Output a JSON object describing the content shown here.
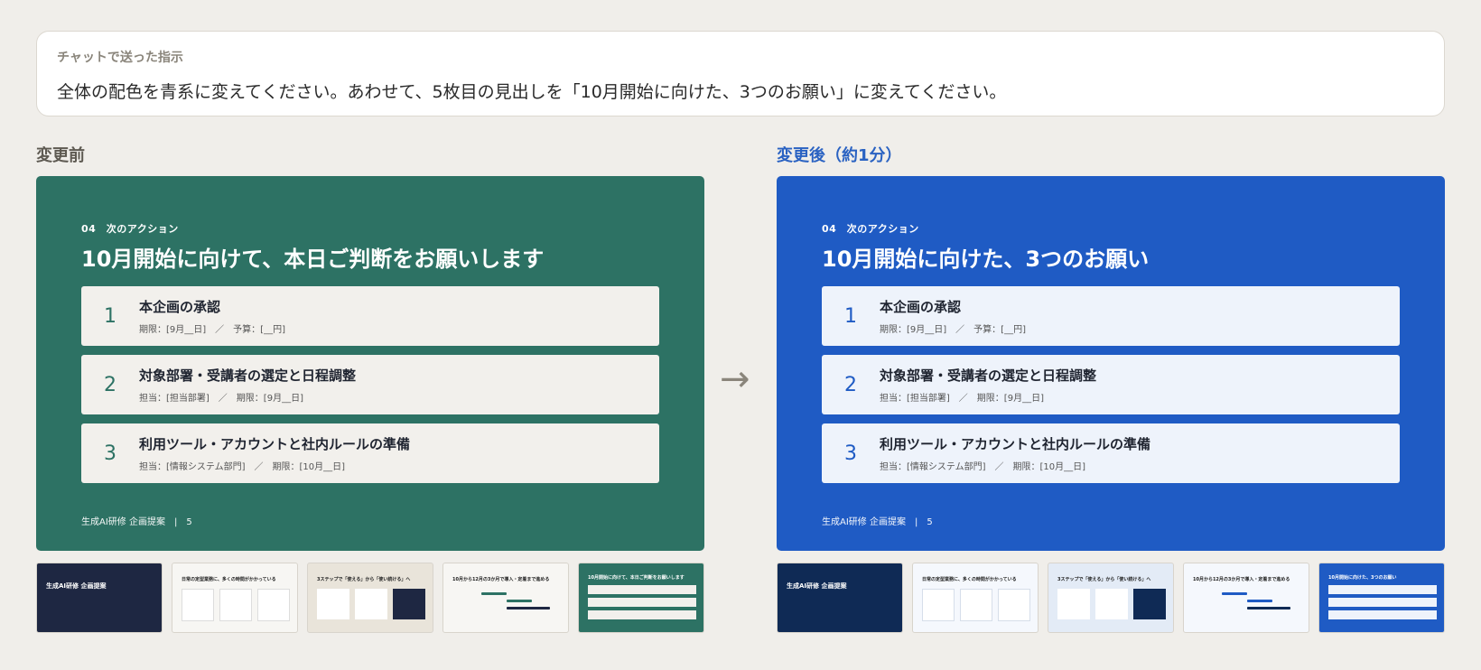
{
  "instruction": {
    "label": "チャットで送った指示",
    "text": "全体の配色を青系に変えてください。あわせて、5枚目の見出しを「10月開始に向けた、3つのお願い」に変えてください。"
  },
  "before": {
    "section_title": "変更前",
    "slide": {
      "kicker": "04　次のアクション",
      "headline": "10月開始に向けて、本日ご判断をお願いします",
      "items": [
        {
          "num": "1",
          "title": "本企画の承認",
          "meta": "期限：[9月__日]　／　予算：[__円]"
        },
        {
          "num": "2",
          "title": "対象部署・受講者の選定と日程調整",
          "meta": "担当：[担当部署]　／　期限：[9月__日]"
        },
        {
          "num": "3",
          "title": "利用ツール・アカウントと社内ルールの準備",
          "meta": "担当：[情報システム部門]　／　期限：[10月__日]"
        }
      ],
      "footer": "生成AI研修 企画提案",
      "page": "5"
    },
    "thumbs": [
      {
        "title": "生成AI研修 企画提案"
      },
      {
        "title": "日常の定型業務に、多くの時間がかかっている"
      },
      {
        "title": "3ステップで「使える」から「使い続ける」へ"
      },
      {
        "title": "10月から12月の3か月で導入・定着まで進める"
      },
      {
        "title": "10月開始に向けて、本日ご判断をお願いします"
      }
    ]
  },
  "after": {
    "section_title": "変更後（約1分）",
    "slide": {
      "kicker": "04　次のアクション",
      "headline": "10月開始に向けた、3つのお願い",
      "items": [
        {
          "num": "1",
          "title": "本企画の承認",
          "meta": "期限：[9月__日]　／　予算：[__円]"
        },
        {
          "num": "2",
          "title": "対象部署・受講者の選定と日程調整",
          "meta": "担当：[担当部署]　／　期限：[9月__日]"
        },
        {
          "num": "3",
          "title": "利用ツール・アカウントと社内ルールの準備",
          "meta": "担当：[情報システム部門]　／　期限：[10月__日]"
        }
      ],
      "footer": "生成AI研修 企画提案",
      "page": "5"
    },
    "thumbs": [
      {
        "title": "生成AI研修 企画提案"
      },
      {
        "title": "日常の定型業務に、多くの時間がかかっている"
      },
      {
        "title": "3ステップで「使える」から「使い続ける」へ"
      },
      {
        "title": "10月から12月の3か月で導入・定着まで進める"
      },
      {
        "title": "10月開始に向けた、3つのお願い"
      }
    ]
  },
  "arrow_icon": "arrow-right-icon",
  "colors": {
    "green": "#2d7264",
    "blue": "#1f5bc4",
    "navy_before": "#1e2742",
    "navy_after": "#0f2a55"
  }
}
